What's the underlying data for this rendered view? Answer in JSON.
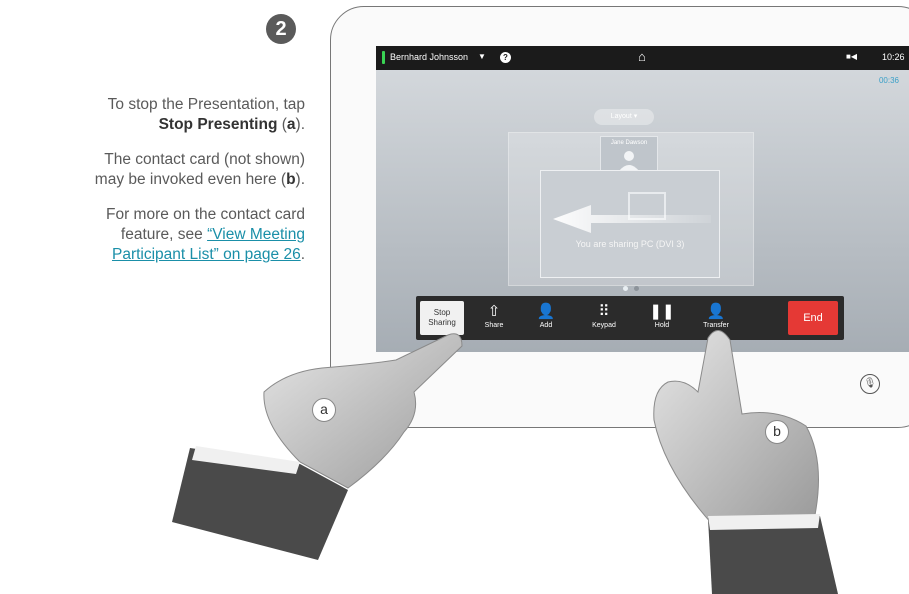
{
  "step_number": "2",
  "instructions": {
    "p1_line1": "To stop the Presentation, tap",
    "p1_bold": "Stop Presenting",
    "p1_open": " (",
    "p1_letter": "a",
    "p1_close": ").",
    "p2_line1": "The contact card (not shown)",
    "p2_line2_pre": "may be invoked even here (",
    "p2_letter": "b",
    "p2_close": ").",
    "p3_line1": "For more on the contact card",
    "p3_line2_pre": "feature, see ",
    "p3_link1": "“View Meeting",
    "p3_link2": "Participant List” on page 26",
    "p3_end": "."
  },
  "topbar": {
    "caller_name": "Bernhard Johnsson",
    "dropdown_glyph": "▼",
    "help_glyph": "?",
    "home_glyph": "⌂",
    "camera_glyph": "■◀",
    "time": "10:26"
  },
  "call_timer": "00:36",
  "layout_label": "Layout",
  "self_view_name": "Jane Dawson",
  "share_text": "You are sharing PC (DVI 3)",
  "toolbar": {
    "stop_line1": "Stop",
    "stop_line2": "Sharing",
    "share_label": "Share",
    "add_label": "Add",
    "keypad_label": "Keypad",
    "hold_label": "Hold",
    "transfer_label": "Transfer",
    "end_label": "End"
  },
  "mute_glyph": "🎙",
  "hand_tags": {
    "a": "a",
    "b": "b"
  }
}
